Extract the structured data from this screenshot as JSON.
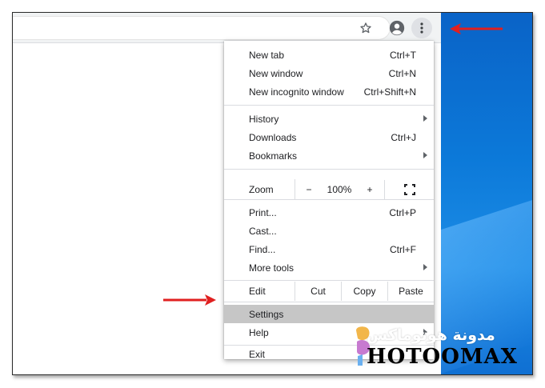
{
  "menu": {
    "items_a": [
      {
        "label": "New tab",
        "shortcut": "Ctrl+T"
      },
      {
        "label": "New window",
        "shortcut": "Ctrl+N"
      },
      {
        "label": "New incognito window",
        "shortcut": "Ctrl+Shift+N"
      }
    ],
    "items_b": [
      {
        "label": "History",
        "shortcut": ""
      },
      {
        "label": "Downloads",
        "shortcut": "Ctrl+J"
      },
      {
        "label": "Bookmarks",
        "shortcut": ""
      }
    ],
    "zoom": {
      "label": "Zoom",
      "minus": "−",
      "level": "100%",
      "plus": "+"
    },
    "items_c": [
      {
        "label": "Print...",
        "shortcut": "Ctrl+P"
      },
      {
        "label": "Cast...",
        "shortcut": ""
      },
      {
        "label": "Find...",
        "shortcut": "Ctrl+F"
      },
      {
        "label": "More tools",
        "shortcut": ""
      }
    ],
    "edit": {
      "label": "Edit",
      "cut": "Cut",
      "copy": "Copy",
      "paste": "Paste"
    },
    "items_d": [
      {
        "label": "Settings",
        "shortcut": ""
      },
      {
        "label": "Help",
        "shortcut": ""
      }
    ],
    "exit": {
      "label": "Exit"
    }
  },
  "colors": {
    "highlight": "#c6c6c6",
    "arrow": "#e02020",
    "desktop": "#0c79d9"
  },
  "icons": [
    "star-icon",
    "account-icon",
    "more-vert-icon",
    "fullscreen-icon",
    "submenu-arrow-icon"
  ],
  "watermark": {
    "arabic": "مدونة هوتوماكس",
    "latin": "HOTOOMAX"
  }
}
